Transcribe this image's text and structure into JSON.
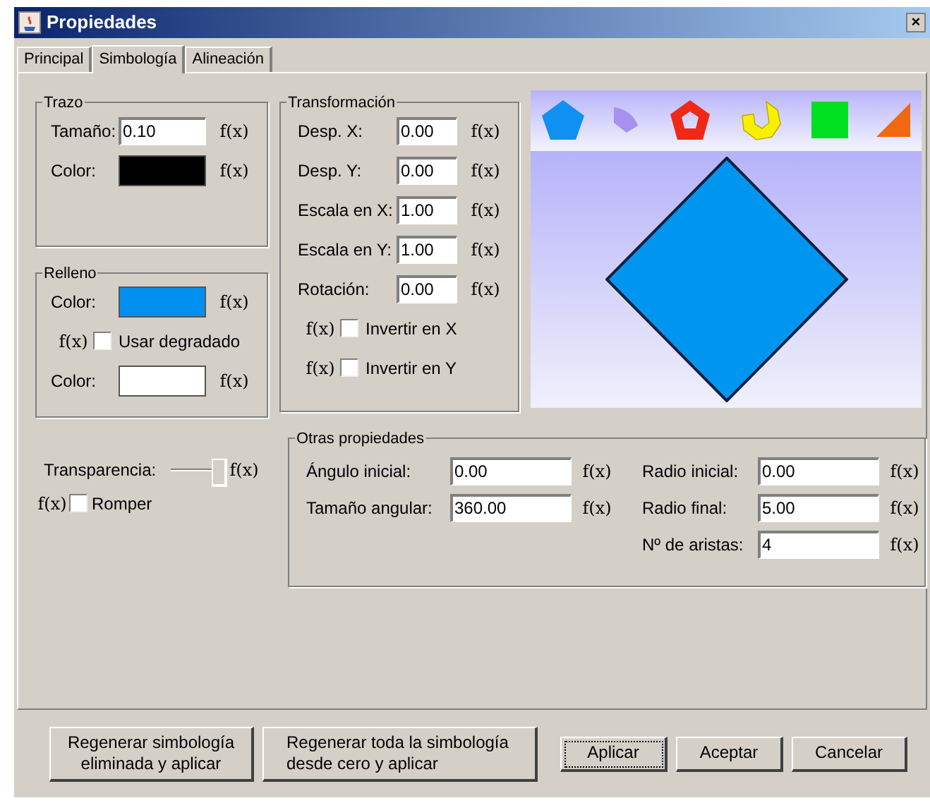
{
  "window": {
    "title": "Propiedades",
    "close": "×"
  },
  "tabs": [
    {
      "label": "Principal",
      "selected": false
    },
    {
      "label": "Simbología",
      "selected": true
    },
    {
      "label": "Alineación",
      "selected": false
    }
  ],
  "trazo": {
    "title": "Trazo",
    "rows": [
      {
        "kind": "text",
        "label": "Tamaño:",
        "value": "0.10",
        "fx": "f(x)"
      },
      {
        "kind": "color",
        "label": "Color:",
        "color": "#000000",
        "fx": "f(x)"
      }
    ]
  },
  "relleno": {
    "title": "Relleno",
    "rows": [
      {
        "kind": "color",
        "label": "Color:",
        "color": "#0090f0",
        "fx": "f(x)"
      },
      {
        "kind": "check",
        "fx": "f(x)",
        "label": "Usar degradado",
        "checked": false
      },
      {
        "kind": "color",
        "label": "Color:",
        "color": "#ffffff",
        "fx": "f(x)"
      }
    ]
  },
  "transformacion": {
    "title": "Transformación",
    "rows": [
      {
        "kind": "text",
        "label": "Desp. X:",
        "value": "0.00",
        "fx": "f(x)"
      },
      {
        "kind": "text",
        "label": "Desp. Y:",
        "value": "0.00",
        "fx": "f(x)"
      },
      {
        "kind": "text",
        "label": "Escala en X:",
        "value": "1.00",
        "fx": "f(x)"
      },
      {
        "kind": "text",
        "label": "Escala en Y:",
        "value": "1.00",
        "fx": "f(x)"
      },
      {
        "kind": "text",
        "label": "Rotación:",
        "value": "0.00",
        "fx": "f(x)"
      },
      {
        "kind": "check",
        "fx": "f(x)",
        "label": "Invertir en X",
        "checked": false
      },
      {
        "kind": "check",
        "fx": "f(x)",
        "label": "Invertir en Y",
        "checked": false
      }
    ]
  },
  "transparencia": {
    "label": "Transparencia:",
    "level": 1,
    "fx": "f(x)"
  },
  "romper": {
    "fx": "f(x)",
    "label": "Romper",
    "checked": false
  },
  "otras": {
    "title": "Otras propiedades",
    "columns": [
      [
        {
          "label": "Ángulo inicial:",
          "value": "0.00",
          "fx": "f(x)"
        },
        {
          "label": "Tamaño angular:",
          "value": "360.00",
          "fx": "f(x)"
        }
      ],
      [
        {
          "label": "Radio inicial:",
          "value": "0.00",
          "fx": "f(x)"
        },
        {
          "label": "Radio final:",
          "value": "5.00",
          "fx": "f(x)"
        },
        {
          "label": "Nº de aristas:",
          "value": "4",
          "fx": "f(x)"
        }
      ]
    ]
  },
  "buttons": [
    {
      "label": "Regenerar simbología eliminada y aplicar",
      "focused": false
    },
    {
      "label": "Regenerar toda la simbología desde cero y aplicar",
      "focused": false
    },
    {
      "label": "Aplicar",
      "focused": true
    },
    {
      "label": "Aceptar",
      "focused": false
    },
    {
      "label": "Cancelar",
      "focused": false
    }
  ]
}
